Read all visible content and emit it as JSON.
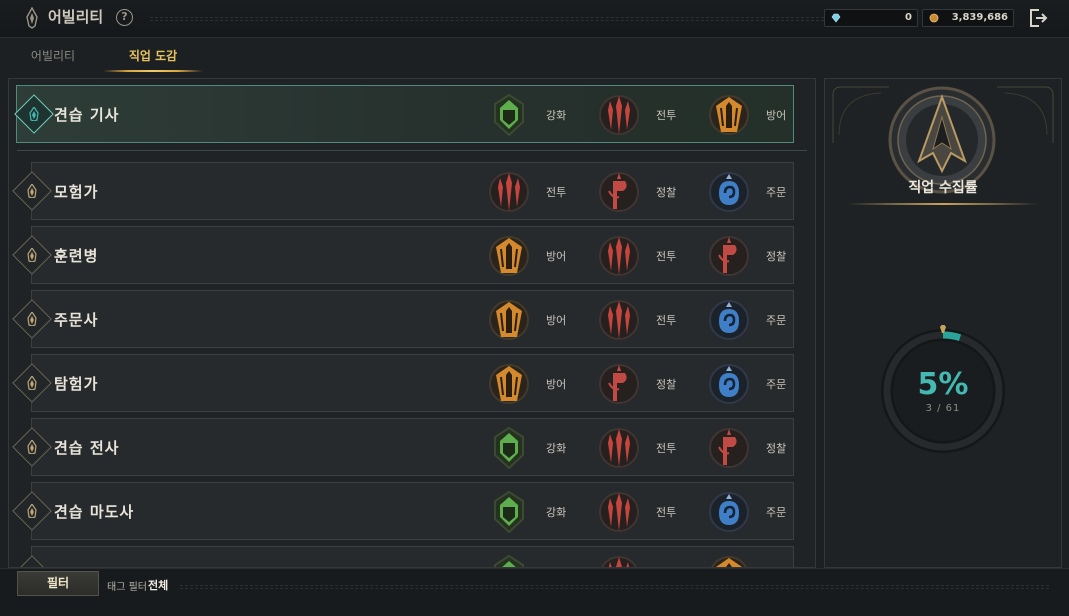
{
  "header": {
    "title": "어빌리티",
    "help_icon": "?",
    "currencies": [
      {
        "icon": "gem-icon",
        "value": "0"
      },
      {
        "icon": "coin-icon",
        "value": "3,839,686"
      }
    ]
  },
  "tabs": [
    {
      "label": "어빌리티",
      "active": false
    },
    {
      "label": "직업 도감",
      "active": true
    }
  ],
  "colors": {
    "enhance": "#5fae4e",
    "combat": "#c6463f",
    "scout": "#c14a44",
    "defense": "#d48a2c",
    "spell": "#3f7fc8",
    "accent": "#43b9b1",
    "gold": "#e6c25e"
  },
  "classes": [
    {
      "name": "견습 기사",
      "selected": true,
      "tags": [
        {
          "label": "강화",
          "type": "enhance"
        },
        {
          "label": "전투",
          "type": "combat"
        },
        {
          "label": "방어",
          "type": "defense"
        }
      ]
    },
    {
      "name": "모험가",
      "selected": false,
      "tags": [
        {
          "label": "전투",
          "type": "combat"
        },
        {
          "label": "정찰",
          "type": "scout"
        },
        {
          "label": "주문",
          "type": "spell"
        }
      ]
    },
    {
      "name": "훈련병",
      "selected": false,
      "tags": [
        {
          "label": "방어",
          "type": "defense"
        },
        {
          "label": "전투",
          "type": "combat"
        },
        {
          "label": "정찰",
          "type": "scout"
        }
      ]
    },
    {
      "name": "주문사",
      "selected": false,
      "tags": [
        {
          "label": "방어",
          "type": "defense"
        },
        {
          "label": "전투",
          "type": "combat"
        },
        {
          "label": "주문",
          "type": "spell"
        }
      ]
    },
    {
      "name": "탐험가",
      "selected": false,
      "tags": [
        {
          "label": "방어",
          "type": "defense"
        },
        {
          "label": "정찰",
          "type": "scout"
        },
        {
          "label": "주문",
          "type": "spell"
        }
      ]
    },
    {
      "name": "견습 전사",
      "selected": false,
      "tags": [
        {
          "label": "강화",
          "type": "enhance"
        },
        {
          "label": "전투",
          "type": "combat"
        },
        {
          "label": "정찰",
          "type": "scout"
        }
      ]
    },
    {
      "name": "견습 마도사",
      "selected": false,
      "tags": [
        {
          "label": "강화",
          "type": "enhance"
        },
        {
          "label": "전투",
          "type": "combat"
        },
        {
          "label": "주문",
          "type": "spell"
        }
      ]
    },
    {
      "name": "",
      "selected": false,
      "partial": true,
      "tags": [
        {
          "label": "",
          "type": "enhance"
        },
        {
          "label": "",
          "type": "combat"
        },
        {
          "label": "",
          "type": "defense"
        }
      ]
    }
  ],
  "collection": {
    "title": "직업 수집률",
    "percent_text": "5%",
    "count_text": "3 / 61",
    "collected": 3,
    "total": 61
  },
  "footer": {
    "filter_button": "필터",
    "tag_filter_label": "태그 필터",
    "tag_filter_value": "전체"
  }
}
